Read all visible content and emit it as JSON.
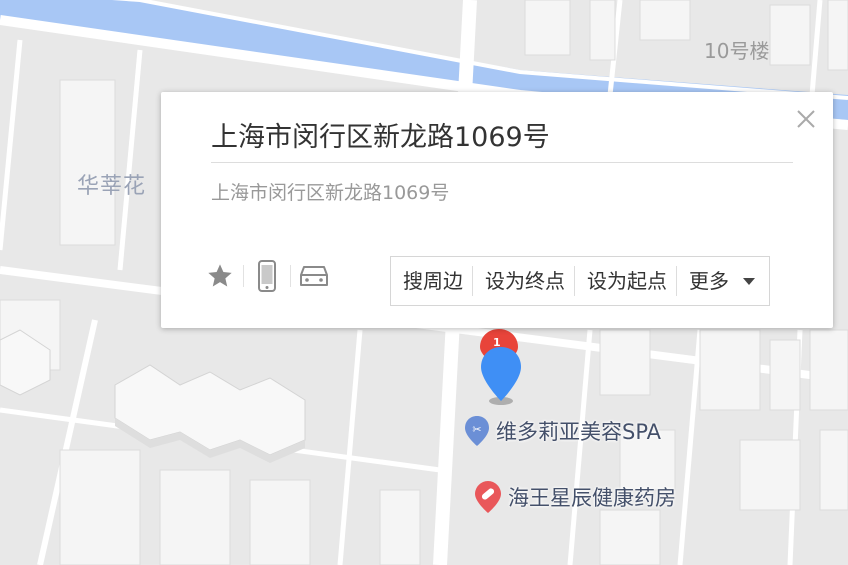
{
  "map": {
    "building_label": "10号楼",
    "area_label": "华莘花",
    "pois": [
      {
        "name": "维多莉亚美容SPA",
        "icon": "spa-icon",
        "color": "#6b8fd6"
      },
      {
        "name": "海王星辰健康药房",
        "icon": "pharmacy-icon",
        "color": "#e9575a"
      }
    ],
    "markers": [
      {
        "label": "1",
        "color": "#e8443a"
      },
      {
        "label": "",
        "color": "#3f8ff5"
      }
    ],
    "colors": {
      "background": "#ededed",
      "block": "#e6e6e6",
      "road": "#ffffff",
      "river": "#a8c7f5",
      "building": "#f6f6f6"
    }
  },
  "popup": {
    "title": "上海市闵行区新龙路1069号",
    "address": "上海市闵行区新龙路1069号",
    "close_icon": "close-icon",
    "tools": [
      {
        "icon": "star-icon"
      },
      {
        "icon": "phone-icon"
      },
      {
        "icon": "car-icon"
      }
    ],
    "actions": {
      "search_nearby": "搜周边",
      "set_end": "设为终点",
      "set_start": "设为起点",
      "more": "更多"
    }
  }
}
